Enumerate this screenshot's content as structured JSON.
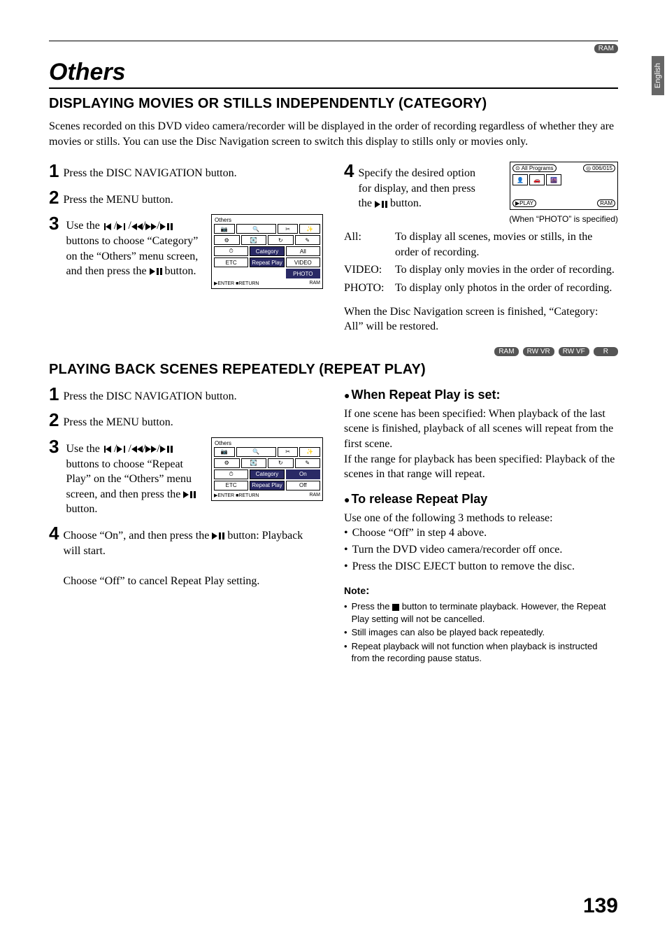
{
  "side_tab": "English",
  "top_badge": "RAM",
  "title": "Others",
  "section1": {
    "heading": "DISPLAYING MOVIES OR STILLS INDEPENDENTLY (CATEGORY)",
    "intro": "Scenes recorded on this DVD video camera/recorder will be displayed in the order of recording regardless of whether they are movies or stills. You can use the Disc Navigation screen to switch this display to stills only or movies only.",
    "steps_left": {
      "s1": "Press the DISC NAVIGATION button.",
      "s2": "Press the MENU button.",
      "s3a": "Use the ",
      "s3b": " buttons to choose “Category” on the “Others” menu screen, and then press the ",
      "s3c": " button."
    },
    "menu_fig": {
      "title": "Others",
      "row_cat_label": "Category",
      "row_rep_label": "Repeat Play",
      "opt_all": "All",
      "opt_video": "VIDEO",
      "opt_photo": "PHOTO",
      "footer_enter": "ENTER",
      "footer_return": "RETURN",
      "footer_right": "RAM",
      "etc": "ETC"
    },
    "steps_right": {
      "s4a": "Specify the desired option for display, and then press the ",
      "s4b": " button."
    },
    "screen_fig": {
      "disc_icon": "⊙",
      "top_title": "All Programs",
      "camera_icon": "◎",
      "counter": "006/015",
      "bot_left": "▶PLAY",
      "bot_right": "RAM"
    },
    "caption": "(When “PHOTO” is specified)",
    "defs": {
      "all_t": "All:",
      "all_d": "To display all scenes, movies or stills, in the order of recording.",
      "video_t": "VIDEO:",
      "video_d": "To display only movies in the order of recording.",
      "photo_t": "PHOTO:",
      "photo_d": "To display only photos in the order of recording."
    },
    "closing": "When the Disc Navigation screen is finished, “Category: All” will be restored."
  },
  "mid_badges": [
    "RAM",
    "RW VR",
    "RW VF",
    "R"
  ],
  "section2": {
    "heading": "PLAYING BACK SCENES REPEATEDLY (REPEAT PLAY)",
    "steps_left": {
      "s1": "Press the DISC NAVIGATION button.",
      "s2": "Press the MENU button.",
      "s3a": "Use the ",
      "s3b": " buttons to choose “Repeat Play” on the “Others” menu screen, and then press the ",
      "s3c": " button.",
      "s4a": "Choose “On”, and then press the ",
      "s4b": " button: Playback will start.",
      "s4c": "Choose “Off” to cancel Repeat Play setting."
    },
    "menu_fig": {
      "title": "Others",
      "row_cat_label": "Category",
      "row_rep_label": "Repeat Play",
      "opt_on": "On",
      "opt_off": "Off",
      "footer_enter": "ENTER",
      "footer_return": "RETURN",
      "footer_right": "RAM",
      "etc": "ETC"
    },
    "sub1": {
      "heading": "When Repeat Play is set:",
      "p1": "If one scene has been specified: When playback of the last scene is finished, playback of all scenes will repeat from the first scene.",
      "p2": "If the range for playback has been specified: Playback of the scenes in that range will repeat."
    },
    "sub2": {
      "heading": "To release Repeat Play",
      "intro": "Use one of the following 3 methods to release:",
      "items": [
        "Choose “Off” in step 4 above.",
        "Turn the DVD video camera/recorder off once.",
        "Press the DISC EJECT button to remove the disc."
      ]
    },
    "note": {
      "heading": "Note",
      "items": [
        "Press the ■ button to terminate playback. However, the Repeat Play setting will not be cancelled.",
        "Still images can also be played back repeatedly.",
        "Repeat playback will not function when playback is instructed from the recording pause status."
      ]
    }
  },
  "page_number": "139"
}
